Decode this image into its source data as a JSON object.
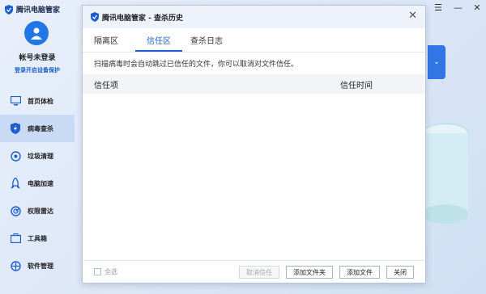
{
  "app": {
    "title": "腾讯电脑管家"
  },
  "window_controls": [
    "—",
    "☰",
    "—",
    "✕"
  ],
  "sidebar": {
    "login_text": "帐号未登录",
    "login_sub": "登录开启设备保护",
    "items": [
      {
        "label": "首页体检",
        "icon": "monitor-icon"
      },
      {
        "label": "病毒查杀",
        "icon": "lightning-shield-icon",
        "active": true
      },
      {
        "label": "垃圾清理",
        "icon": "cleanup-icon"
      },
      {
        "label": "电脑加速",
        "icon": "rocket-icon"
      },
      {
        "label": "权限雷达",
        "icon": "radar-icon"
      },
      {
        "label": "工具箱",
        "icon": "toolbox-icon"
      },
      {
        "label": "软件管理",
        "icon": "software-icon"
      }
    ]
  },
  "dialog": {
    "title": "腾讯电脑管家 - 查杀历史",
    "tabs": [
      {
        "label": "隔离区",
        "active": false
      },
      {
        "label": "信任区",
        "active": true
      },
      {
        "label": "查杀日志",
        "active": false
      }
    ],
    "description": "扫描病毒时会自动跳过已信任的文件，你可以取消对文件信任。",
    "columns": {
      "item": "信任项",
      "time": "信任时间"
    },
    "rows": [],
    "footer": {
      "select_all": "全选",
      "buttons": {
        "remove_trust": "取消信任",
        "add_folder": "添加文件夹",
        "add_file": "添加文件",
        "close": "关闭"
      }
    }
  },
  "colors": {
    "accent": "#1d5fd0",
    "brand_blue": "#2277e8"
  }
}
